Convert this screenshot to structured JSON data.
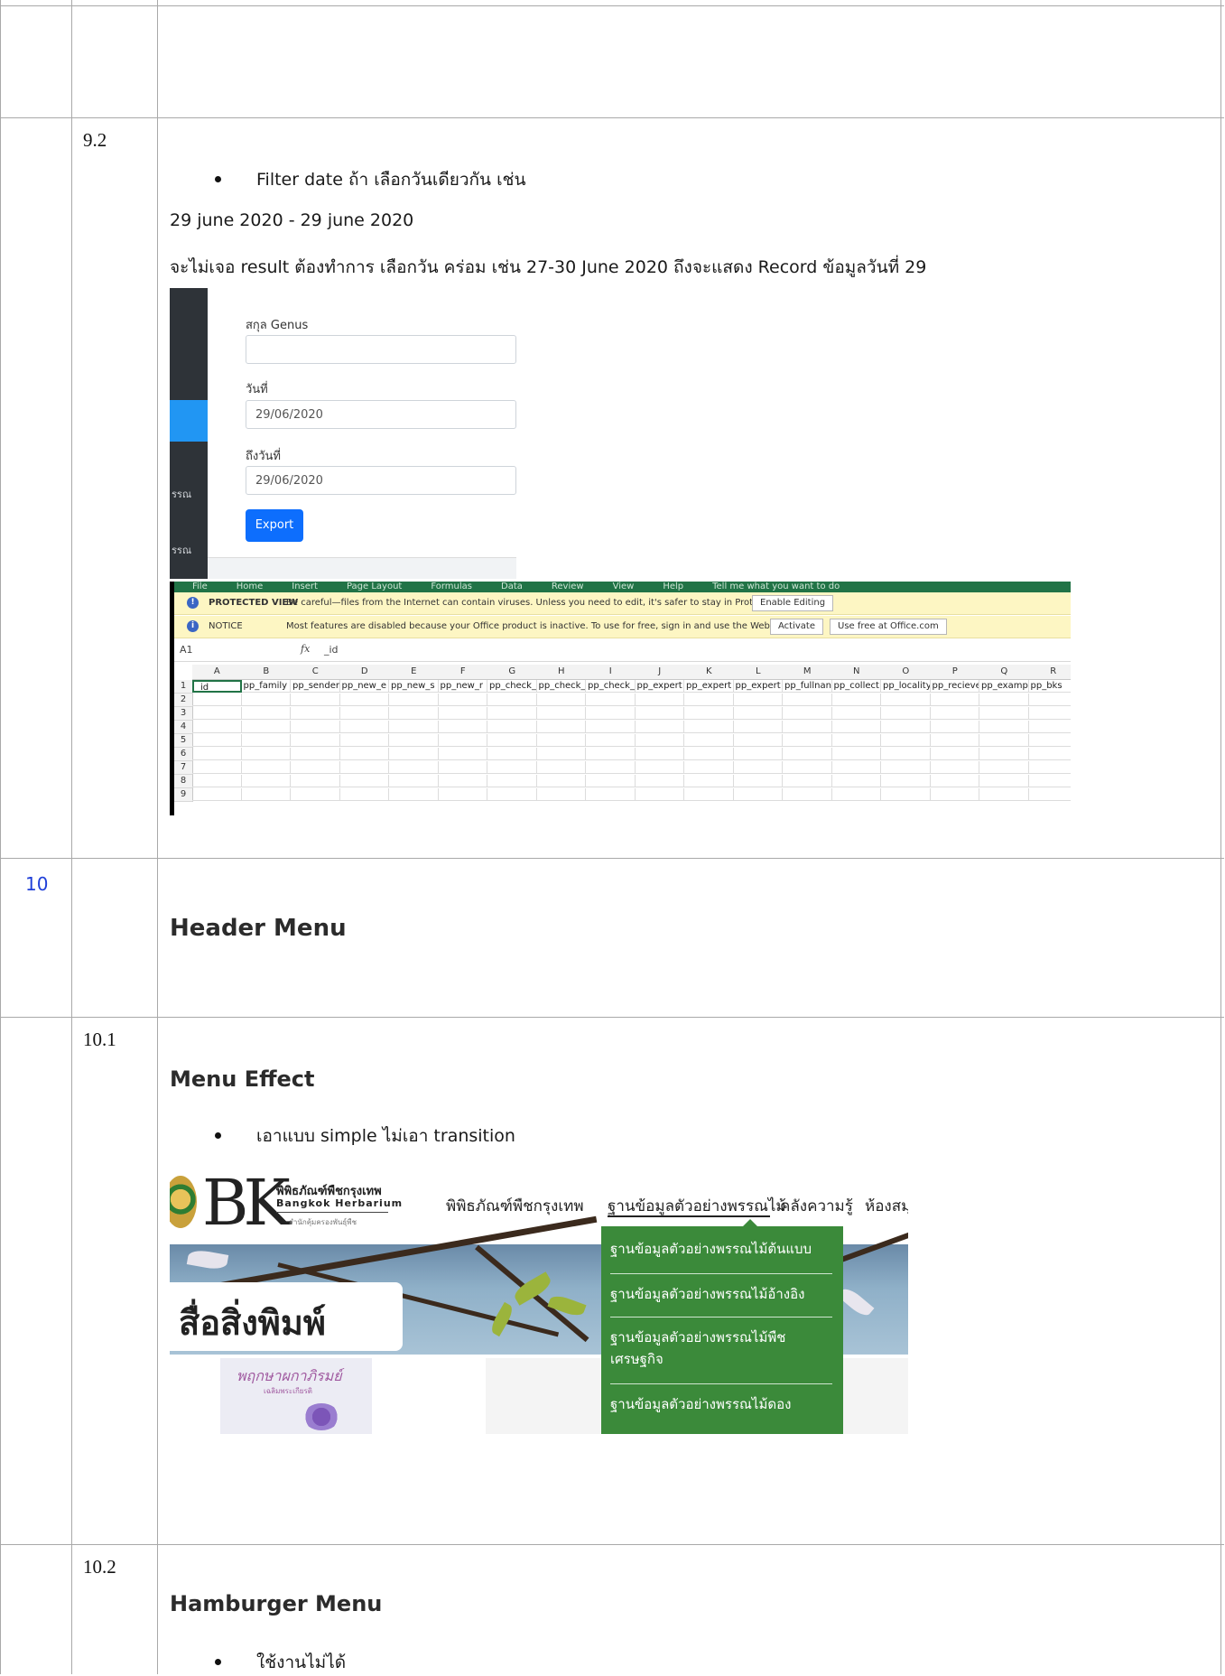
{
  "rows": {
    "r9_2": {
      "number": "9.2",
      "bullet": "Filter date ถ้า เลือกวันเดียวกัน เช่น",
      "line2": "29 june 2020 - 29 june 2020",
      "line3": "จะไม่เจอ result ต้องทำการ เลือกวัน คร่อม เช่น 27-30 June 2020 ถึงจะแสดง Record ข้อมูลวันที่ 29"
    },
    "r10": {
      "number": "10",
      "heading": "Header Menu"
    },
    "r10_1": {
      "number": "10.1",
      "heading": "Menu Effect",
      "bullet": "เอาแบบ simple ไม่เอา transition"
    },
    "r10_2": {
      "number": "10.2",
      "heading": "Hamburger Menu",
      "bullet": "ใช้งานไม่ได้"
    }
  },
  "form_shot": {
    "side_labels": [
      "รรณ",
      "รรณ"
    ],
    "genus_label": "สกุล Genus",
    "date_label": "วันที่",
    "date_value": "29/06/2020",
    "to_date_label": "ถึงวันที่",
    "to_date_value": "29/06/2020",
    "export_label": "Export"
  },
  "excel_shot": {
    "ribbon": [
      "File",
      "Home",
      "Insert",
      "Page Layout",
      "Formulas",
      "Data",
      "Review",
      "View",
      "Help",
      "Tell me what you want to do"
    ],
    "protected_title": "PROTECTED VIEW",
    "protected_text": "Be careful—files from the Internet can contain viruses. Unless you need to edit, it's safer to stay in Protected View.",
    "enable_editing": "Enable Editing",
    "notice_title": "NOTICE",
    "notice_text": "Most features are disabled because your Office product is inactive. To use for free, sign in and use the Web version.",
    "activate": "Activate",
    "use_free": "Use free at Office.com",
    "name_box": "A1",
    "formula": "_id",
    "columns": [
      "A",
      "B",
      "C",
      "D",
      "E",
      "F",
      "G",
      "H",
      "I",
      "J",
      "K",
      "L",
      "M",
      "N",
      "O",
      "P",
      "Q",
      "R"
    ],
    "row1": [
      "_id",
      "pp_family",
      "pp_sender",
      "pp_new_e",
      "pp_new_s",
      "pp_new_r",
      "pp_check_",
      "pp_check_",
      "pp_check_",
      "pp_expert",
      "pp_expert",
      "pp_expert",
      "pp_fullnan",
      "pp_collect",
      "pp_locality",
      "pp_recieve",
      "pp_examp",
      "pp_bks"
    ],
    "row_numbers": [
      "1",
      "2",
      "3",
      "4",
      "5",
      "6",
      "7",
      "8",
      "9"
    ]
  },
  "web_shot": {
    "logo_th": "พิพิธภัณฑ์พืชกรุงเทพ",
    "logo_en": "Bangkok Herbarium",
    "logo_sub": "สำนักคุ้มครองพันธุ์พืช",
    "nav": [
      "พิพิธภัณฑ์พืชกรุงเทพ",
      "ฐานข้อมูลตัวอย่างพรรณไม้",
      "คลังความรู้",
      "ห้องสมุ"
    ],
    "hero_title": "สื่อสิ่งพิมพ์",
    "book_title": "พฤกษาผกาภิรมย์",
    "book_sub": "เฉลิมพระเกียรติ",
    "dropdown": [
      "ฐานข้อมูลตัวอย่างพรรณไม้ต้นแบบ",
      "ฐานข้อมูลตัวอย่างพรรณไม้อ้างอิง",
      "ฐานข้อมูลตัวอย่างพรรณไม้พืช",
      "เศรษฐกิจ",
      "ฐานข้อมูลตัวอย่างพรรณไม้ดอง"
    ]
  },
  "colors": {
    "dropdown_green": "#3b8a3a",
    "excel_green": "#217346",
    "link_blue": "#1f3fd8"
  }
}
